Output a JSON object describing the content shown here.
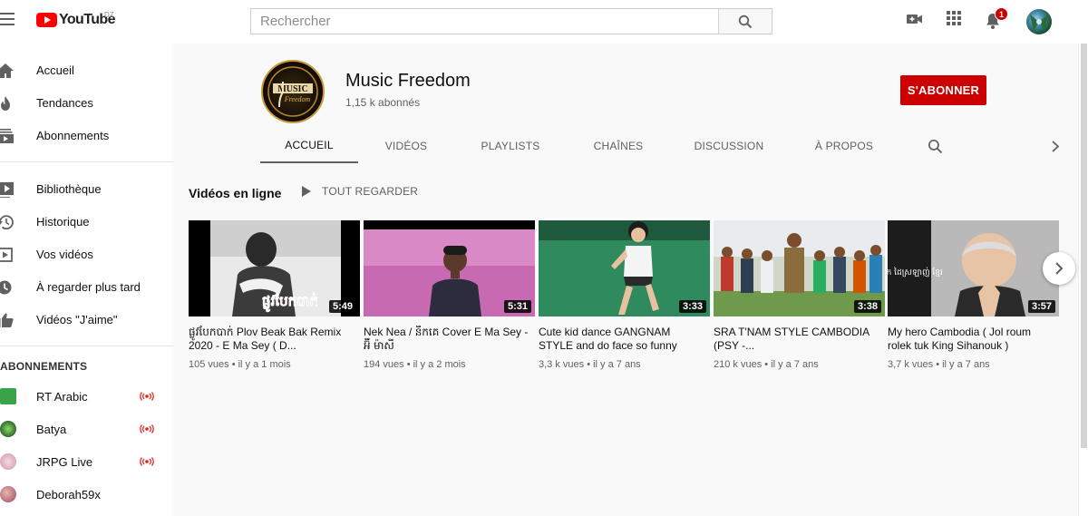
{
  "header": {
    "logo_text": "YouTube",
    "country_code": "DZ",
    "search_placeholder": "Rechercher",
    "notification_count": "1",
    "icons": [
      "menu-icon",
      "create-video-icon",
      "apps-grid-icon",
      "bell-icon",
      "search-icon"
    ]
  },
  "sidebar": {
    "main": [
      {
        "label": "Accueil",
        "icon": "home-icon"
      },
      {
        "label": "Tendances",
        "icon": "trending-icon"
      },
      {
        "label": "Abonnements",
        "icon": "subscriptions-icon"
      }
    ],
    "library": [
      {
        "label": "Bibliothèque",
        "icon": "library-icon"
      },
      {
        "label": "Historique",
        "icon": "history-icon"
      },
      {
        "label": "Vos vidéos",
        "icon": "your-videos-icon"
      },
      {
        "label": "À regarder plus tard",
        "icon": "watch-later-icon"
      },
      {
        "label": "Vidéos \"J'aime\"",
        "icon": "liked-icon"
      }
    ],
    "subscriptions_title": "ABONNEMENTS",
    "subscriptions": [
      {
        "name": "RT Arabic",
        "live": true,
        "color": "#3aa34a"
      },
      {
        "name": "Batya",
        "live": true,
        "color": "#2f6d2b"
      },
      {
        "name": "JRPG Live",
        "live": true,
        "color": "#d9a9b8"
      },
      {
        "name": "Deborah59x",
        "live": false,
        "color": "#b06a7a"
      }
    ]
  },
  "channel": {
    "name": "Music Freedom",
    "subscribers": "1,15 k abonnés",
    "subscribe_label": "S'ABONNER",
    "logo_text_1": "MUSIC",
    "logo_text_2": "Freedom"
  },
  "tabs": [
    "ACCUEIL",
    "VIDÉOS",
    "PLAYLISTS",
    "CHAÎNES",
    "DISCUSSION",
    "À PROPOS"
  ],
  "shelf": {
    "title": "Vidéos en ligne",
    "play_all": "TOUT REGARDER",
    "videos": [
      {
        "title": "ផ្លូវបែកបាក់ Plov Beak Bak Remix 2020 - E Ma Sey ( D...",
        "meta": "105 vues • il y a 1 mois",
        "duration": "5:49",
        "thumb_overlay_text": "ផ្លូវបែកបាក់"
      },
      {
        "title": "Nek Nea / នឹកគេ Cover E Ma Sey - អ៊ី ម៉ាសី",
        "meta": "194 vues • il y a 2 mois",
        "duration": "5:31"
      },
      {
        "title": "Cute kid dance GANGNAM STYLE and do face so funny",
        "meta": "3,3 k vues • il y a 7 ans",
        "duration": "3:33"
      },
      {
        "title": "SRA T'NAM STYLE CAMBODIA (PSY -...",
        "meta": "210 k vues • il y a 7 ans",
        "duration": "3:38"
      },
      {
        "title": "My hero Cambodia ( Jol roum rolek tuk King Sihanouk )",
        "meta": "3,7 k vues • il y a 7 ans",
        "duration": "3:57",
        "thumb_overlay_text": "ឪពុក ដៃស្រឡាញ់ ខ្មែរ"
      }
    ]
  },
  "colors": {
    "accent_red": "#cc0000",
    "background": "#f9f9f9"
  }
}
